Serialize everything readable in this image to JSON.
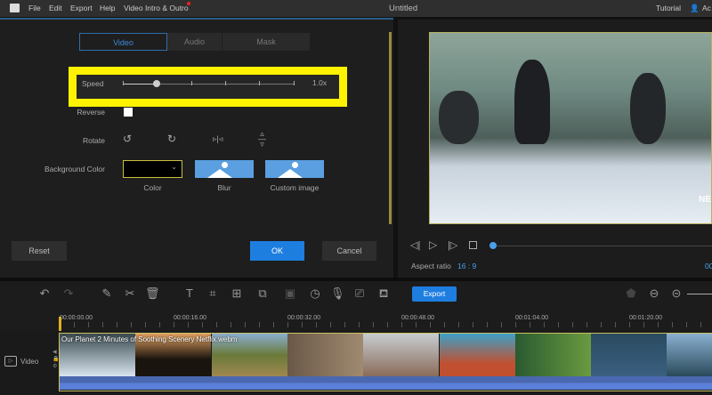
{
  "menu": {
    "items": [
      "File",
      "Edit",
      "Export",
      "Help",
      "Video Intro & Outro"
    ],
    "title": "Untitled",
    "tutorial": "Tutorial",
    "account": "Ac"
  },
  "tabs": [
    "Video",
    "Audio",
    "Mask"
  ],
  "speed": {
    "label": "Speed",
    "value": "1.0x",
    "fraction": 0.2
  },
  "reverse": {
    "label": "Reverse",
    "checked": false
  },
  "rotate": {
    "label": "Rotate"
  },
  "background": {
    "label": "Background Color",
    "options": [
      "Color",
      "Blur",
      "Custom image"
    ]
  },
  "buttons": {
    "reset": "Reset",
    "ok": "OK",
    "cancel": "Cancel",
    "export": "Export"
  },
  "preview": {
    "aspect_label": "Aspect ratio",
    "aspect_value": "16 : 9",
    "time_partial": "00",
    "watermark": "NE",
    "progress": 0.0
  },
  "timeline": {
    "ticks": [
      "00:00:00.00",
      "00:00:16.00",
      "00:00:32.00",
      "00:00:48.00",
      "00:01:04.00",
      "00:01:20.00"
    ],
    "track_label": "Video",
    "clip_name": "Our Planet 2 Minutes of Soothing Scenery Netflix.webm"
  },
  "colors": {
    "accent": "#1e7ee0",
    "highlight": "#fff200"
  }
}
